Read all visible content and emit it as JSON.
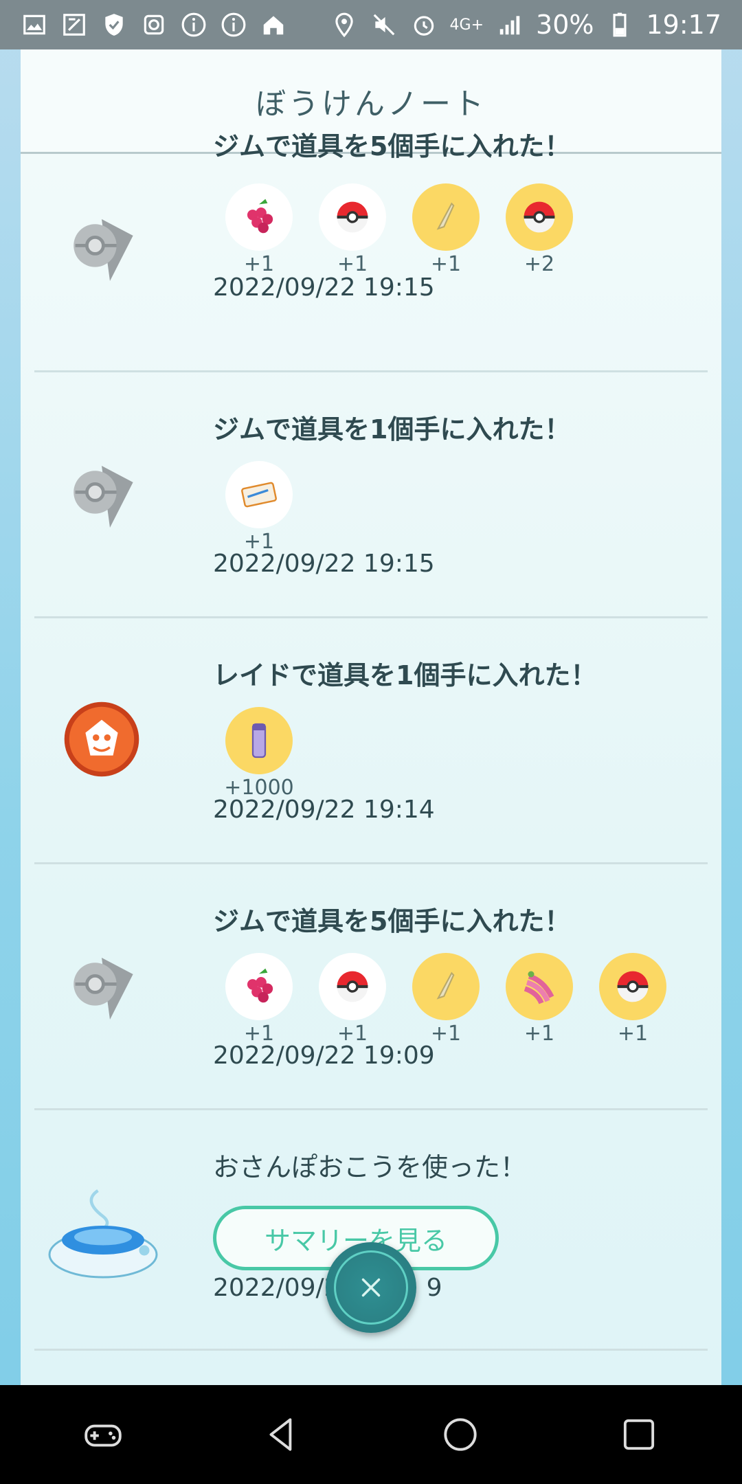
{
  "status_bar": {
    "battery": "30%",
    "time": "19:17",
    "network": "4G+"
  },
  "header": {
    "title": "ぼうけんノート"
  },
  "entries": [
    {
      "icon": "gym-icon",
      "title": "ジムで道具を5個手に入れた！",
      "items": [
        {
          "icon": "raspberry-icon",
          "bg": "white",
          "count": "+1"
        },
        {
          "icon": "pokeball-icon",
          "bg": "white",
          "count": "+1"
        },
        {
          "icon": "tm-icon",
          "bg": "gold",
          "count": "+1"
        },
        {
          "icon": "pokeball-icon",
          "bg": "gold",
          "count": "+2"
        }
      ],
      "time": "2022/09/22 19:15"
    },
    {
      "icon": "gym-icon",
      "title": "ジムで道具を1個手に入れた！",
      "items": [
        {
          "icon": "raid-pass-icon",
          "bg": "white",
          "count": "+1"
        }
      ],
      "time": "2022/09/22 19:15"
    },
    {
      "icon": "raid-icon",
      "title": "レイドで道具を1個手に入れた！",
      "items": [
        {
          "icon": "stardust-candy-icon",
          "bg": "gold",
          "count": "+1000"
        }
      ],
      "time": "2022/09/22 19:14"
    },
    {
      "icon": "gym-icon",
      "title": "ジムで道具を5個手に入れた！",
      "items": [
        {
          "icon": "raspberry-icon",
          "bg": "white",
          "count": "+1"
        },
        {
          "icon": "pokeball-icon",
          "bg": "white",
          "count": "+1"
        },
        {
          "icon": "tm-icon",
          "bg": "gold",
          "count": "+1"
        },
        {
          "icon": "nanab-berry-icon",
          "bg": "gold",
          "count": "+1"
        },
        {
          "icon": "pokeball-icon",
          "bg": "gold",
          "count": "+1"
        }
      ],
      "time": "2022/09/22 19:09"
    },
    {
      "icon": "incense-icon",
      "title": "おさんぽおこうを使った！",
      "button": "サマリーを見る",
      "time": "2022/09/2",
      "time_tail": "9"
    }
  ],
  "colors": {
    "accent": "#48c8a6",
    "gold": "#fbd864",
    "fab": "#2a7f83"
  }
}
